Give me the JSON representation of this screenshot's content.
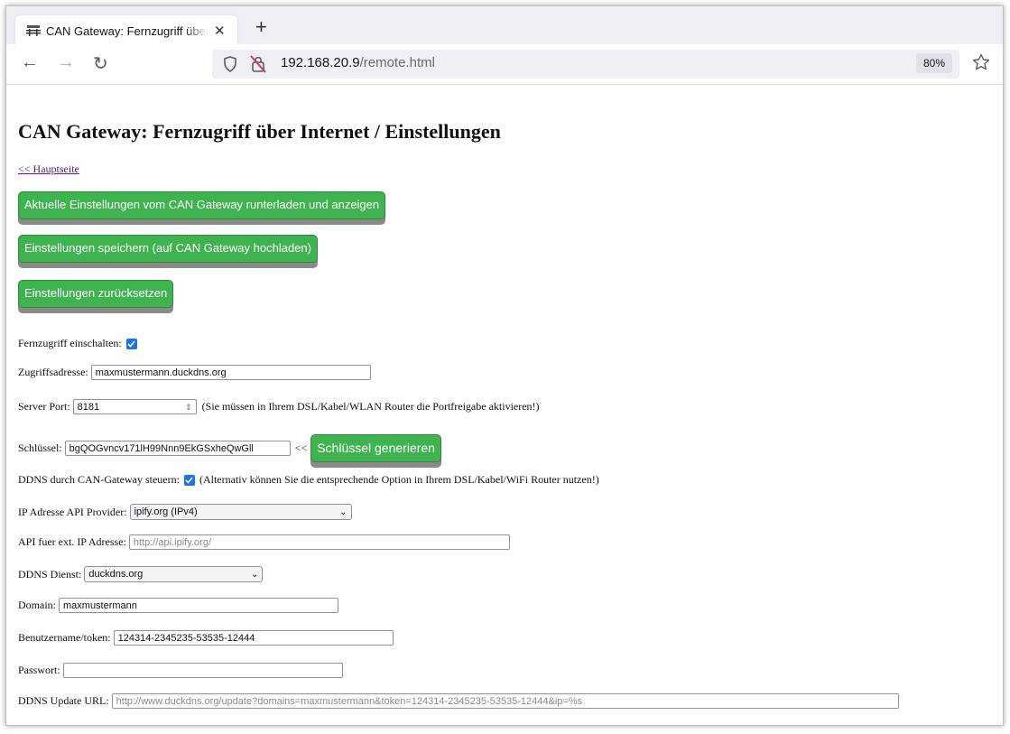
{
  "browser": {
    "tab_title": "CAN Gateway: Fernzugriff über Internet / Einstellungen",
    "url_host": "192.168.20.9",
    "url_path": "/remote.html",
    "zoom": "80%"
  },
  "page": {
    "title": "CAN Gateway: Fernzugriff über Internet / Einstellungen",
    "back_link": "<< Hauptseite",
    "buttons": {
      "download": "Aktuelle Einstellungen vom CAN Gateway runterladen und anzeigen",
      "save": "Einstellungen speichern (auf CAN Gateway hochladen)",
      "reset": "Einstellungen zurücksetzen",
      "generate_key": "Schlüssel generieren"
    },
    "fields": {
      "remote_label": "Fernzugriff einschalten:",
      "remote_checked": true,
      "address_label": "Zugriffsadresse:",
      "address_value": "maxmustermann.duckdns.org",
      "port_label": "Server Port:",
      "port_value": "8181",
      "port_hint": "(Sie müssen in Ihrem DSL/Kabel/WLAN Router die Portfreigabe aktivieren!)",
      "key_label": "Schlüssel:",
      "key_value": "bgQOGvncv171lH99Nnn9EkGSxheQwGll",
      "key_arrow": "<<",
      "ddns_label": "DDNS durch CAN-Gateway steuern:",
      "ddns_checked": true,
      "ddns_hint": "(Alternativ können Sie die entsprechende Option in Ihrem DSL/Kabel/WiFi Router nutzen!)",
      "ip_provider_label": "IP Adresse API Provider:",
      "ip_provider_value": "ipify.org (IPv4)",
      "api_label": "API fuer ext. IP Adresse:",
      "api_value": "http://api.ipify.org/",
      "ddns_service_label": "DDNS Dienst:",
      "ddns_service_value": "duckdns.org",
      "domain_label": "Domain:",
      "domain_value": "maxmustermann",
      "user_label": "Benutzername/token:",
      "user_value": "124314-2345235-53535-12444",
      "password_label": "Passwort:",
      "password_value": "",
      "update_url_label": "DDNS Update URL:",
      "update_url_value": "http://www.duckdns.org/update?domains=maxmustermann&token=124314-2345235-53535-12444&ip=%s"
    }
  }
}
